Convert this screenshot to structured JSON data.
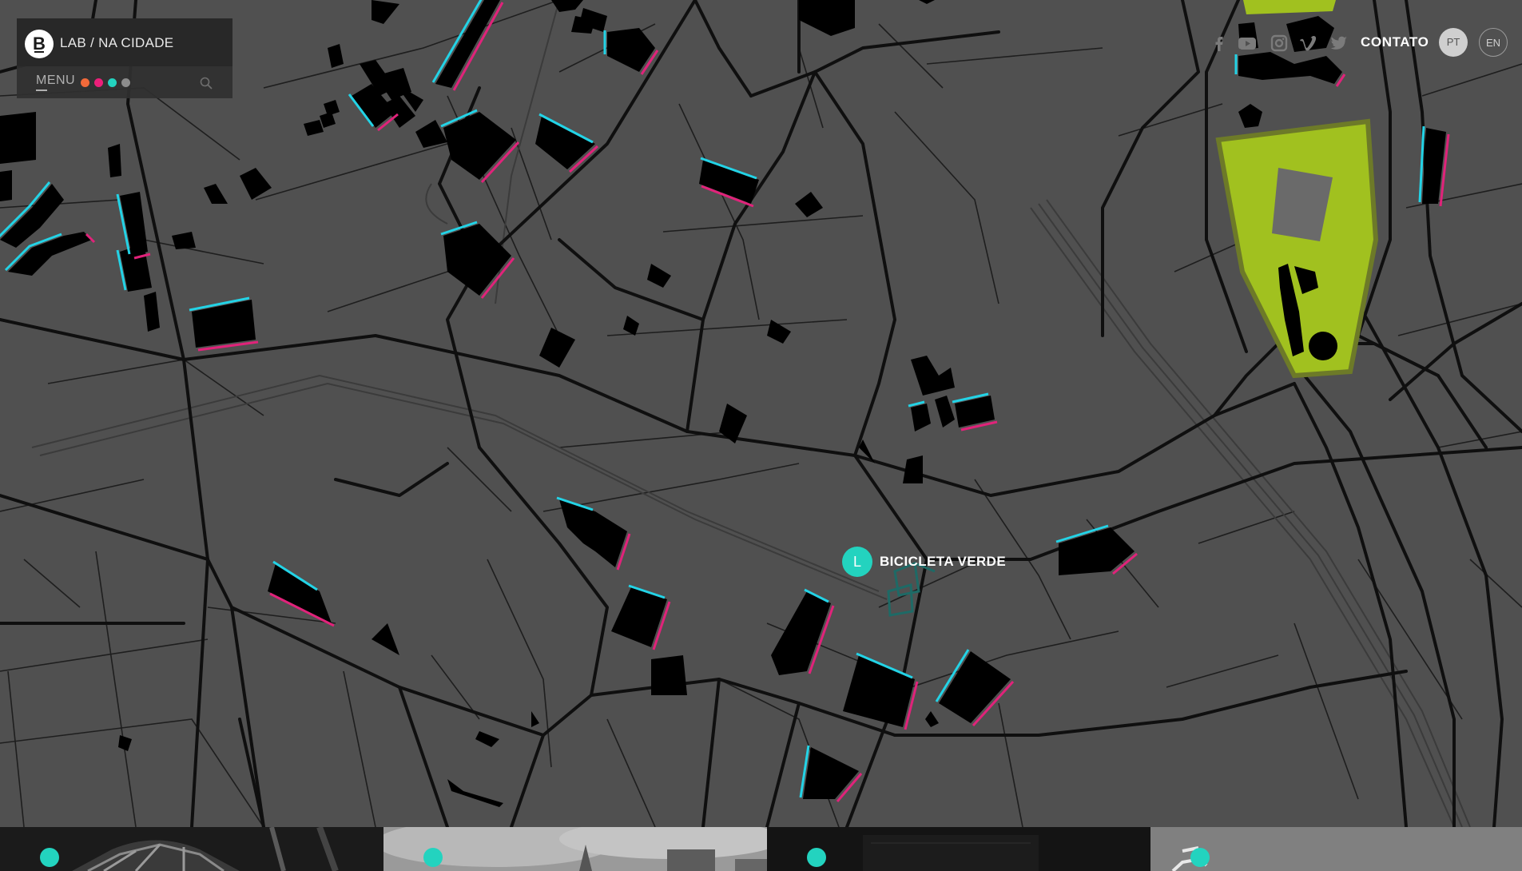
{
  "brand": {
    "logo_letter": "B",
    "title": "LAB / NA CIDADE"
  },
  "menu": {
    "label": "MENU",
    "dots": [
      "#f26a3a",
      "#ec1f7a",
      "#23d3bf",
      "#8c8c8c"
    ]
  },
  "nav": {
    "social": [
      "facebook-icon",
      "youtube-icon",
      "instagram-icon",
      "vimeo-icon",
      "twitter-icon"
    ],
    "contact_label": "CONTATO",
    "languages": [
      "PT",
      "EN"
    ],
    "active_language": "PT"
  },
  "map": {
    "marker_letter": "L",
    "marker_label": "BICICLETA VERDE",
    "colors": {
      "ground": "#505050",
      "roads": "#111111",
      "buildings": "#000000",
      "shadow_cyan": "#23d3e6",
      "shadow_magenta": "#e0237a",
      "park": "#a1c11f",
      "accent": "#23d3bf"
    }
  },
  "cards": [
    {
      "name": "card-1",
      "tone": "#1b1b1b"
    },
    {
      "name": "card-2",
      "tone": "#9a9a9a"
    },
    {
      "name": "card-3",
      "tone": "#141414"
    },
    {
      "name": "card-4",
      "tone": "#7a7a7a"
    }
  ]
}
